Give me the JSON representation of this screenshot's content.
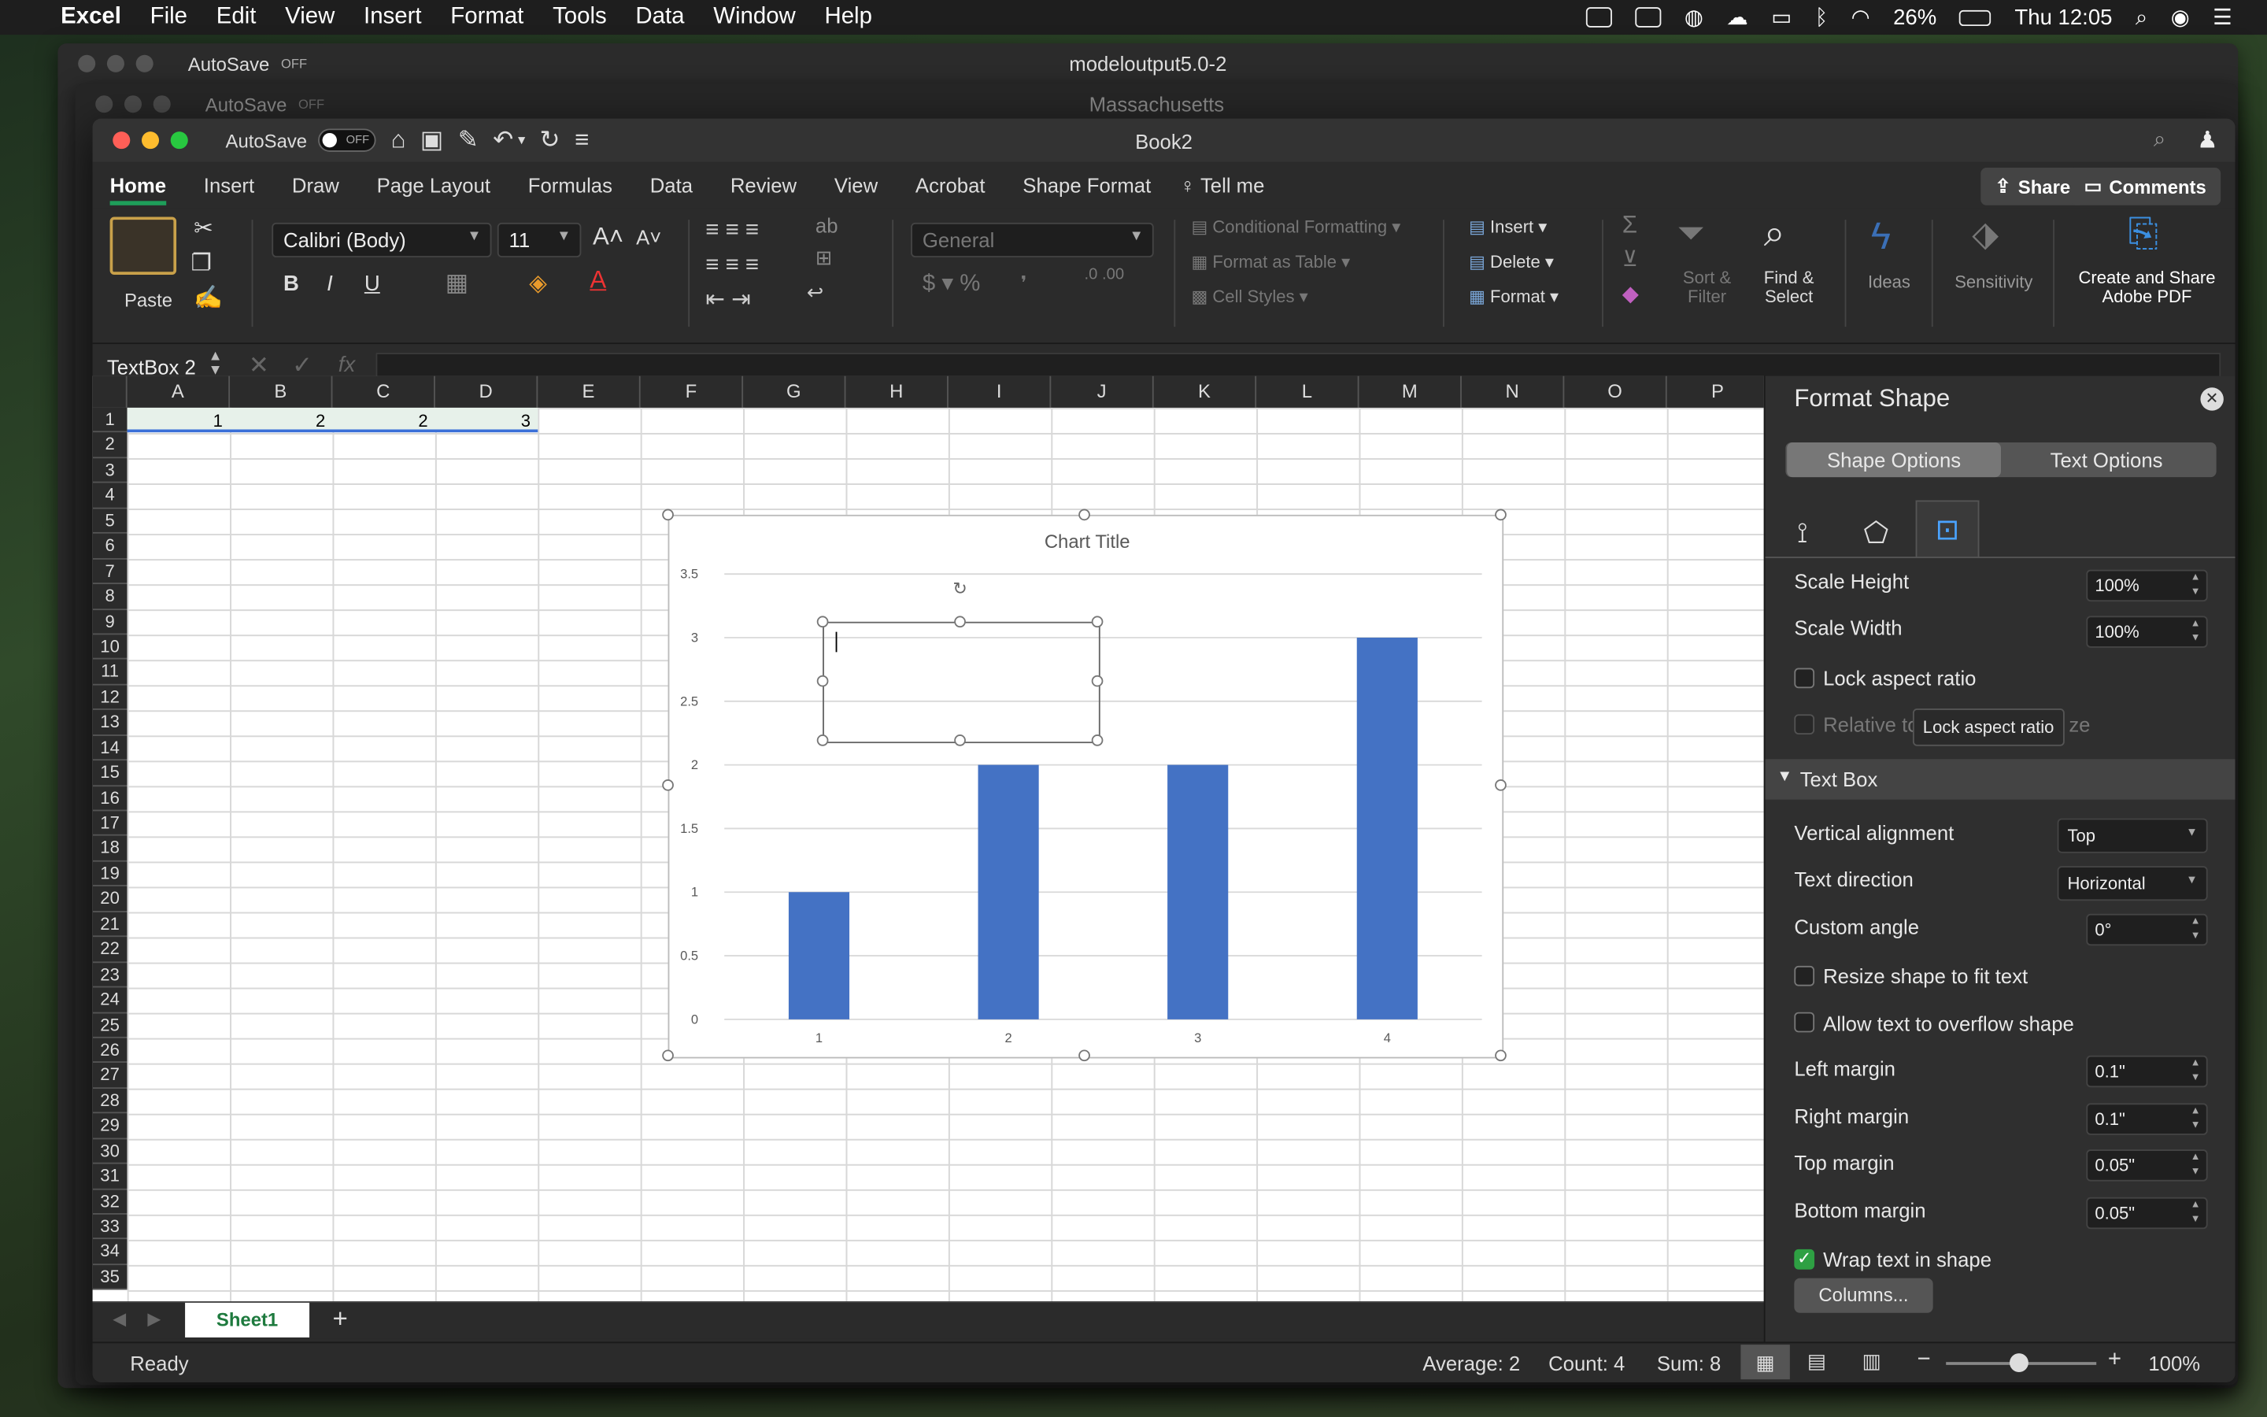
{
  "menubar": {
    "app": "Excel",
    "items": [
      "File",
      "Edit",
      "View",
      "Insert",
      "Format",
      "Tools",
      "Data",
      "Window",
      "Help"
    ],
    "battery": "26%",
    "clock": "Thu 12:05"
  },
  "bg_windows": [
    {
      "title": "modeloutput5.0-2",
      "autosave_label": "AutoSave",
      "toggle": "OFF"
    },
    {
      "title": "Massachusetts",
      "autosave_label": "AutoSave",
      "toggle": "OFF"
    }
  ],
  "window": {
    "title": "Book2",
    "autosave_label": "AutoSave",
    "toggle": "OFF"
  },
  "ribbon_tabs": [
    "Home",
    "Insert",
    "Draw",
    "Page Layout",
    "Formulas",
    "Data",
    "Review",
    "View",
    "Acrobat",
    "Shape Format"
  ],
  "tell_me": "Tell me",
  "share_label": "Share",
  "comments_label": "Comments",
  "ribbon": {
    "paste": "Paste",
    "font_name": "Calibri (Body)",
    "font_size": "11",
    "bold": "B",
    "italic": "I",
    "underline": "U",
    "number_format": "General",
    "conditional_formatting": "Conditional Formatting",
    "format_as_table": "Format as Table",
    "cell_styles": "Cell Styles",
    "insert": "Insert",
    "delete": "Delete",
    "format": "Format",
    "sort_filter_1": "Sort &",
    "sort_filter_2": "Filter",
    "find_select_1": "Find &",
    "find_select_2": "Select",
    "ideas": "Ideas",
    "sensitivity": "Sensitivity",
    "adobe_1": "Create and Share",
    "adobe_2": "Adobe PDF"
  },
  "formula_bar": {
    "name_box": "TextBox 2",
    "fx": "fx",
    "value": ""
  },
  "columns": [
    "A",
    "B",
    "C",
    "D",
    "E",
    "F",
    "G",
    "H",
    "I",
    "J",
    "K",
    "L",
    "M",
    "N",
    "O",
    "P"
  ],
  "rows": [
    "1",
    "2",
    "3",
    "4",
    "5",
    "6",
    "7",
    "8",
    "9",
    "10",
    "11",
    "12",
    "13",
    "14",
    "15",
    "16",
    "17",
    "18",
    "19",
    "20",
    "21",
    "22",
    "23",
    "24",
    "25",
    "26",
    "27",
    "28",
    "29",
    "30",
    "31",
    "32",
    "33",
    "34",
    "35"
  ],
  "row1_values": [
    "1",
    "2",
    "2",
    "3"
  ],
  "chart_data": {
    "type": "bar",
    "title": "Chart Title",
    "categories": [
      "1",
      "2",
      "3",
      "4"
    ],
    "values": [
      1,
      2,
      2,
      3
    ],
    "ylim": [
      0,
      3.5
    ],
    "yticks": [
      "0",
      "0.5",
      "1",
      "1.5",
      "2",
      "2.5",
      "3",
      "3.5"
    ],
    "grid": true,
    "bar_color": "#4472c4"
  },
  "sheet_tab": "Sheet1",
  "add_sheet": "+",
  "status": {
    "ready": "Ready",
    "average": "Average: 2",
    "count": "Count: 4",
    "sum": "Sum: 8",
    "zoom": "100%"
  },
  "pane": {
    "title": "Format Shape",
    "tab_shape": "Shape Options",
    "tab_text": "Text Options",
    "scale_height_label": "Scale Height",
    "scale_height": "100%",
    "scale_width_label": "Scale Width",
    "scale_width": "100%",
    "lock_aspect": "Lock aspect ratio",
    "relative_partial_a": "Relative to",
    "relative_partial_b": "ze",
    "tooltip": "Lock aspect ratio",
    "section": "Text Box",
    "vertical_alignment_label": "Vertical alignment",
    "vertical_alignment": "Top",
    "text_direction_label": "Text direction",
    "text_direction": "Horizontal",
    "custom_angle_label": "Custom angle",
    "custom_angle": "0°",
    "resize_label": "Resize shape to fit text",
    "overflow_label": "Allow text to overflow shape",
    "left_margin_label": "Left margin",
    "left_margin": "0.1\"",
    "right_margin_label": "Right margin",
    "right_margin": "0.1\"",
    "top_margin_label": "Top margin",
    "top_margin": "0.05\"",
    "bottom_margin_label": "Bottom margin",
    "bottom_margin": "0.05\"",
    "wrap_label": "Wrap text in shape",
    "columns_button": "Columns..."
  },
  "colors": {
    "accent_green": "#1e9e5a",
    "bar": "#4472c4",
    "check": "#2ea043"
  }
}
